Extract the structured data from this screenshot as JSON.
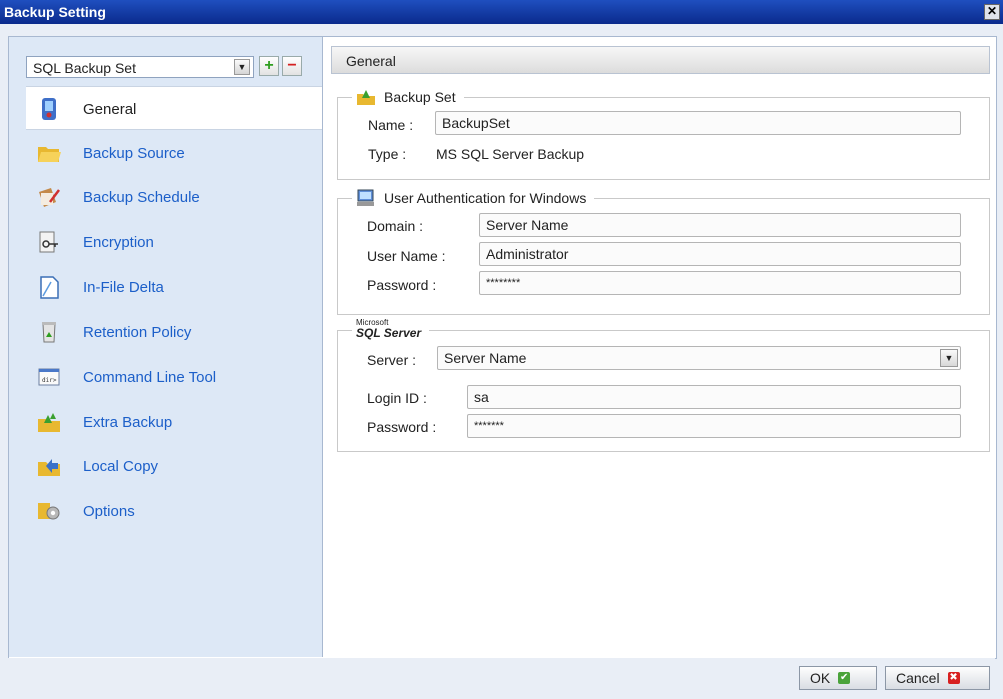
{
  "window": {
    "title": "Backup Setting",
    "close_glyph": "✕"
  },
  "sidebar": {
    "backup_set": "SQL Backup Set",
    "add_glyph": "+",
    "remove_glyph": "−",
    "items": [
      {
        "label": "General",
        "icon": "general-icon",
        "active": true
      },
      {
        "label": "Backup Source",
        "icon": "folder-open-icon"
      },
      {
        "label": "Backup Schedule",
        "icon": "schedule-icon"
      },
      {
        "label": "Encryption",
        "icon": "key-icon"
      },
      {
        "label": "In-File Delta",
        "icon": "document-icon"
      },
      {
        "label": "Retention Policy",
        "icon": "recycle-bin-icon"
      },
      {
        "label": "Command Line Tool",
        "icon": "command-line-icon"
      },
      {
        "label": "Extra Backup",
        "icon": "extra-backup-icon"
      },
      {
        "label": "Local Copy",
        "icon": "local-copy-icon"
      },
      {
        "label": "Options",
        "icon": "options-gear-icon"
      }
    ]
  },
  "main": {
    "header": "General",
    "backup_set": {
      "legend": "Backup Set",
      "name_label": "Name :",
      "name_value": "BackupSet",
      "type_label": "Type :",
      "type_value": "MS SQL Server Backup"
    },
    "windows_auth": {
      "legend": "User Authentication for Windows",
      "domain_label": "Domain :",
      "domain_value": "Server Name",
      "user_label": "User Name :",
      "user_value": "Administrator",
      "password_label": "Password :",
      "password_value": "********"
    },
    "sql_server": {
      "logo_top": "Microsoft",
      "logo_main": "SQL Server",
      "server_label": "Server :",
      "server_value": "Server Name",
      "login_label": "Login ID :",
      "login_value": "sa",
      "password_label": "Password :",
      "password_value": "*******"
    }
  },
  "footer": {
    "ok_label": "OK",
    "ok_glyph": "✔",
    "cancel_label": "Cancel",
    "cancel_glyph": "✖"
  }
}
